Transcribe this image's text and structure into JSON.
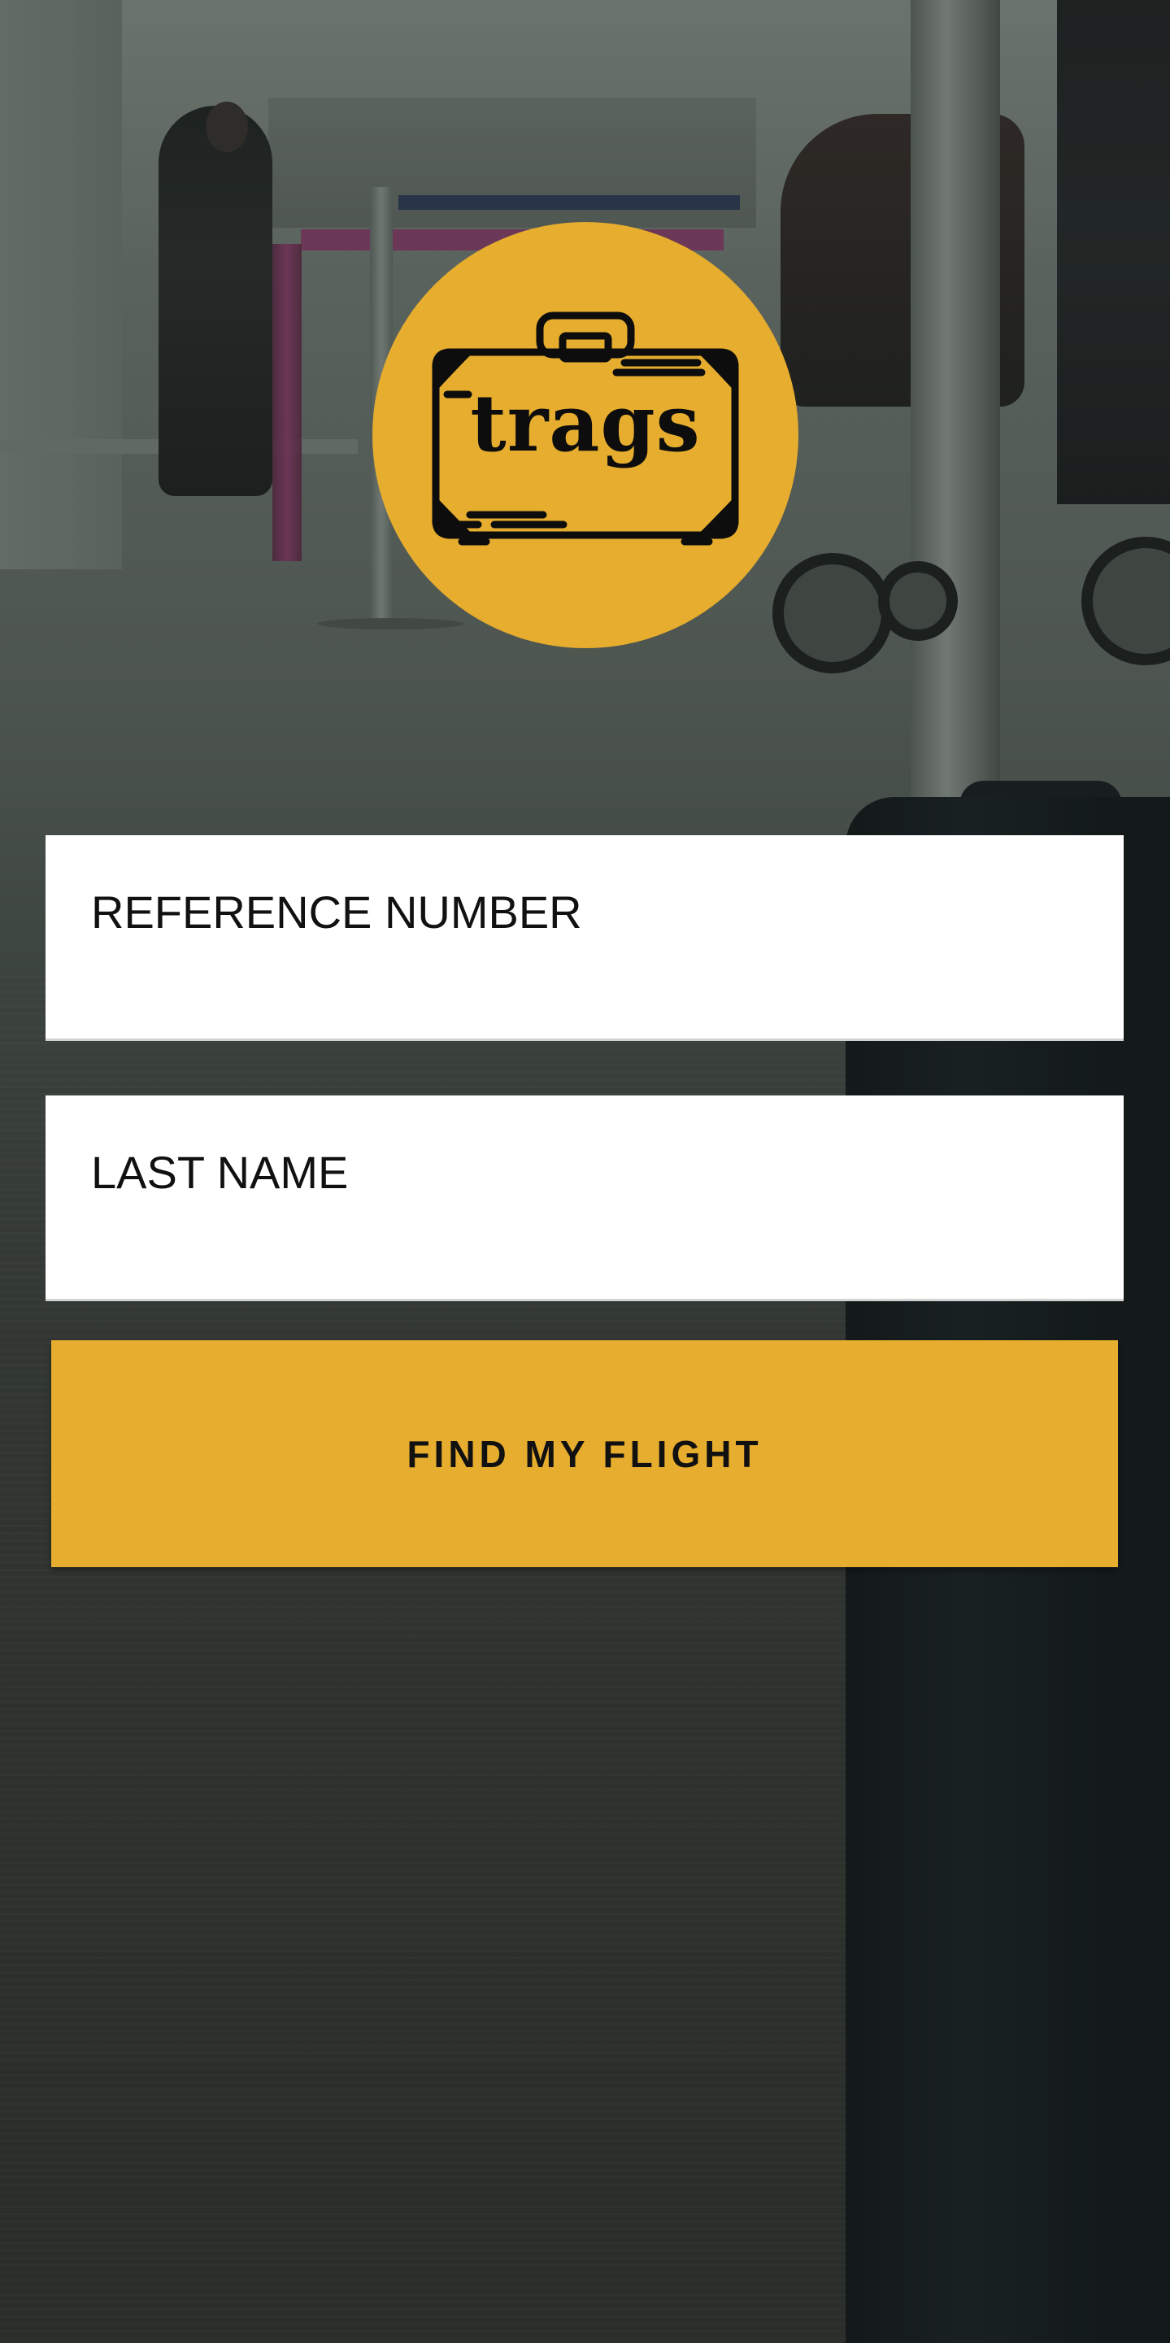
{
  "logo": {
    "text": "trags",
    "icon": "suitcase-icon",
    "color": "#e6ad2e"
  },
  "form": {
    "reference_placeholder": "REFERENCE NUMBER",
    "reference_value": "",
    "last_name_placeholder": "LAST NAME",
    "last_name_value": "",
    "submit_label": "FIND MY FLIGHT"
  },
  "colors": {
    "accent": "#e6ad2e",
    "field_bg": "#ffffff",
    "text": "#111111"
  }
}
